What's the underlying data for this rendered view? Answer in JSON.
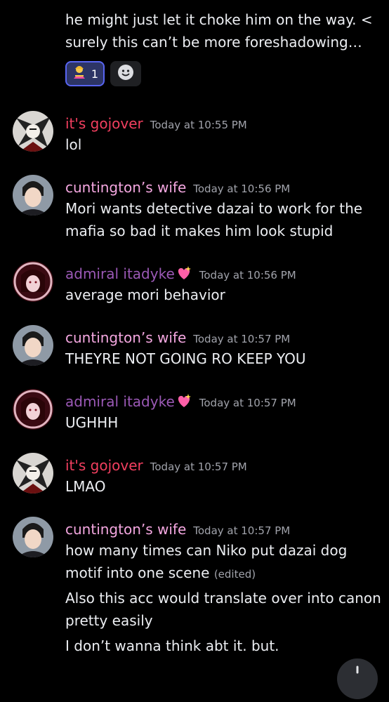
{
  "top_message": {
    "line1": "he might just let it choke him on the way.  <",
    "line2": "surely this can’t be more foreshadowing…",
    "reaction": {
      "emoji": "person-gesturing-no",
      "count": "1"
    },
    "add_reaction_icon": "smile-icon"
  },
  "messages": [
    {
      "author": "it's gojover",
      "color": "#f23f5f",
      "time": "Today at 10:55 PM",
      "lines": [
        "lol"
      ]
    },
    {
      "author": "cuntington’s wife",
      "color": "#f4a7e0",
      "time": "Today at 10:56 PM",
      "lines": [
        "Mori wants detective dazai to work for the",
        "mafia so bad it makes him look stupid"
      ]
    },
    {
      "author": "admiral itadyke",
      "color": "#9b59b6",
      "time": "Today at 10:56 PM",
      "lines": [
        "average mori behavior"
      ]
    },
    {
      "author": "cuntington’s wife",
      "color": "#f4a7e0",
      "time": "Today at 10:57 PM",
      "lines": [
        "THEYRE NOT GOING RO KEEP YOU"
      ]
    },
    {
      "author": "admiral itadyke",
      "color": "#9b59b6",
      "time": "Today at 10:57 PM",
      "lines": [
        "UGHHH"
      ]
    },
    {
      "author": "it's gojover",
      "color": "#f23f5f",
      "time": "Today at 10:57 PM",
      "lines": [
        "LMAO"
      ]
    },
    {
      "author": "cuntington’s wife",
      "color": "#f4a7e0",
      "time": "Today at 10:57 PM",
      "lines": [
        "how many times can Niko put dazai dog",
        "motif into one scene"
      ],
      "edited": "(edited)",
      "followups": [
        "Also this acc would translate over into canon",
        "pretty easily",
        "I don’t wanna think abt it. but."
      ]
    }
  ],
  "icons": {
    "admiral_badge": "sparkling-heart-icon",
    "scroll": "scroll-down-button"
  }
}
